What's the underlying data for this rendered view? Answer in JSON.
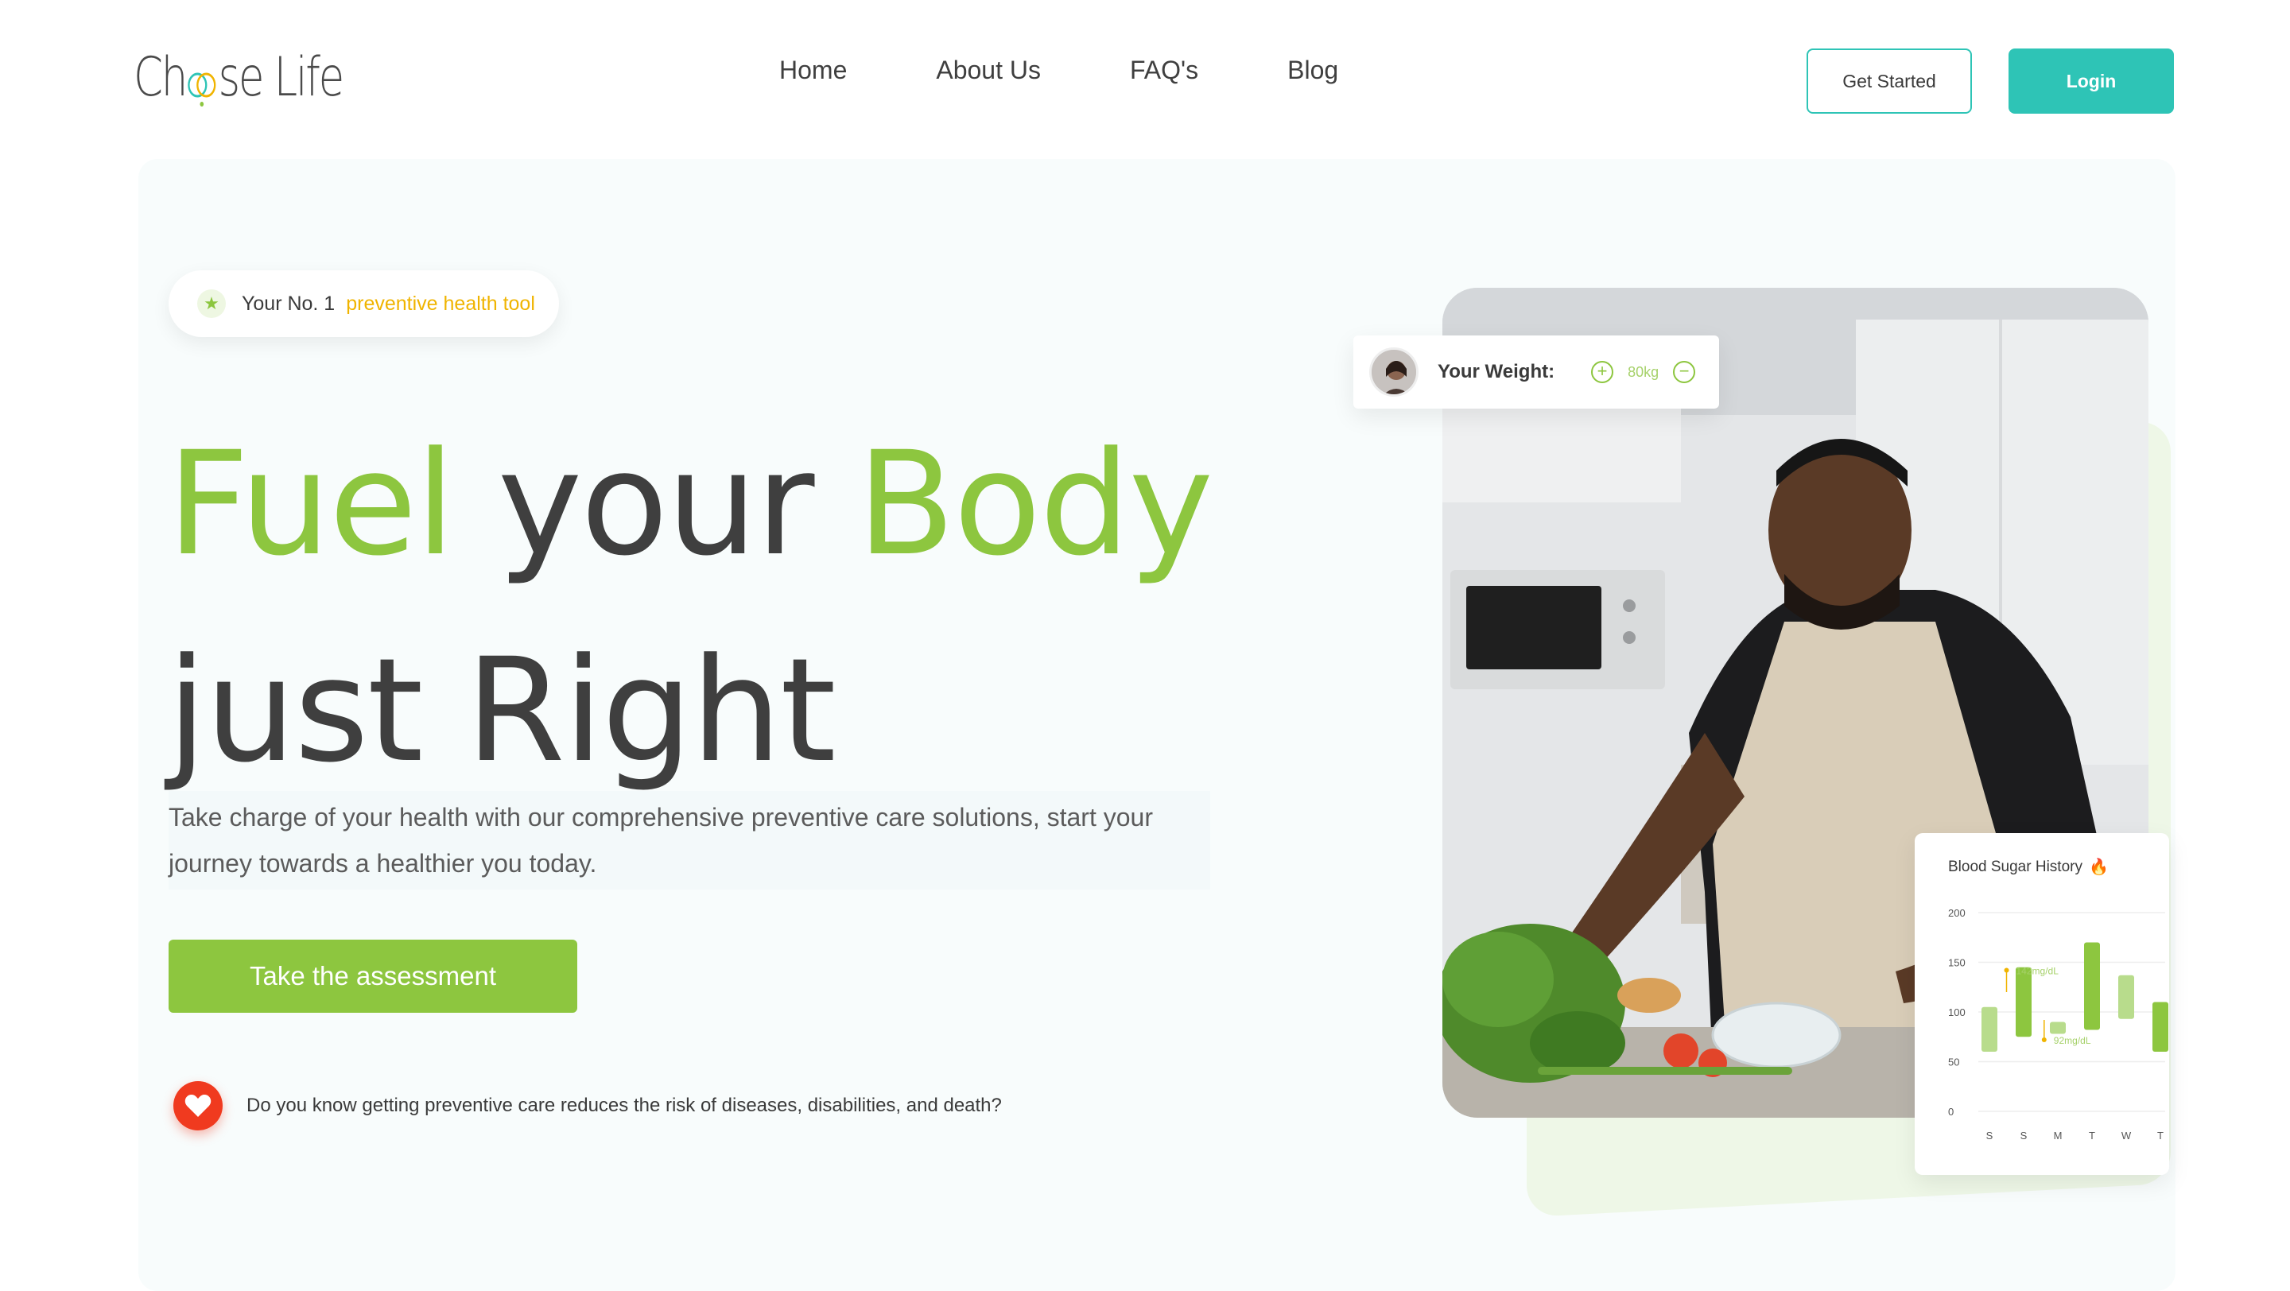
{
  "brand": {
    "logo_text_left": "Ch",
    "logo_text_right": "se Life",
    "accent": "#8dc63f",
    "teal": "#2ec4b6"
  },
  "nav": {
    "links": [
      "Home",
      "About Us",
      "FAQ's",
      "Blog"
    ],
    "get_started": "Get Started",
    "login": "Login"
  },
  "hero": {
    "pill_prefix": "Your No. 1",
    "pill_highlight": "preventive health tool",
    "headline_w1": "Fuel",
    "headline_w2": "your",
    "headline_w3": "Body",
    "headline_line2": "just Right",
    "subtext": "Take charge of your health with our comprehensive preventive care solutions, start your journey towards a healthier you today.",
    "cta": "Take the assessment",
    "fact": "Do you know getting preventive care reduces the risk of diseases, disabilities, and death?"
  },
  "weight_card": {
    "label": "Your Weight:",
    "value": "80kg",
    "plus": "+",
    "minus": "−"
  },
  "chart_data": {
    "type": "bar",
    "title": "Blood Sugar History",
    "categories": [
      "S",
      "S",
      "M",
      "T",
      "W",
      "T"
    ],
    "ylim": [
      0,
      200
    ],
    "yticks": [
      "200",
      "150",
      "100",
      "50",
      "0"
    ],
    "series": [
      {
        "values": [
          [
            60,
            105
          ],
          [
            75,
            145
          ],
          [
            78,
            90
          ],
          [
            82,
            170
          ],
          [
            93,
            137
          ],
          [
            60,
            110
          ]
        ]
      }
    ],
    "annotations": [
      {
        "text": "142mg/dL"
      },
      {
        "text": "92mg/dL"
      }
    ],
    "grid": true
  }
}
